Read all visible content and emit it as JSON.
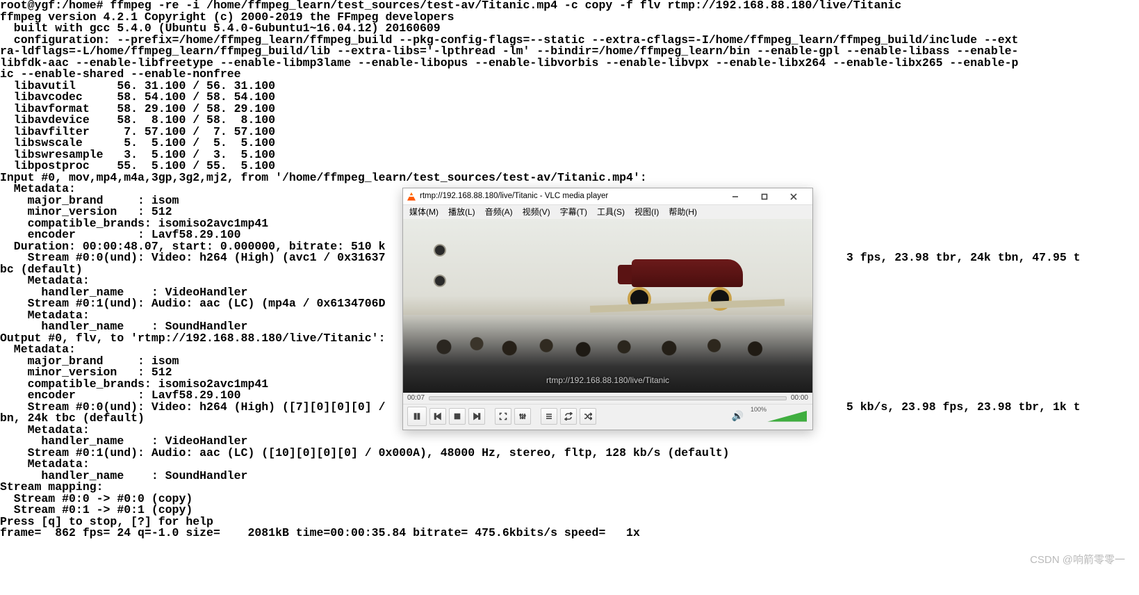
{
  "terminal_text": "root@ygf:/home# ffmpeg -re -i /home/ffmpeg_learn/test_sources/test-av/Titanic.mp4 -c copy -f flv rtmp://192.168.88.180/live/Titanic\nffmpeg version 4.2.1 Copyright (c) 2000-2019 the FFmpeg developers\n  built with gcc 5.4.0 (Ubuntu 5.4.0-6ubuntu1~16.04.12) 20160609\n  configuration: --prefix=/home/ffmpeg_learn/ffmpeg_build --pkg-config-flags=--static --extra-cflags=-I/home/ffmpeg_learn/ffmpeg_build/include --ext\nra-ldflags=-L/home/ffmpeg_learn/ffmpeg_build/lib --extra-libs='-lpthread -lm' --bindir=/home/ffmpeg_learn/bin --enable-gpl --enable-libass --enable-\nlibfdk-aac --enable-libfreetype --enable-libmp3lame --enable-libopus --enable-libvorbis --enable-libvpx --enable-libx264 --enable-libx265 --enable-p\nic --enable-shared --enable-nonfree\n  libavutil      56. 31.100 / 56. 31.100\n  libavcodec     58. 54.100 / 58. 54.100\n  libavformat    58. 29.100 / 58. 29.100\n  libavdevice    58.  8.100 / 58.  8.100\n  libavfilter     7. 57.100 /  7. 57.100\n  libswscale      5.  5.100 /  5.  5.100\n  libswresample   3.  5.100 /  3.  5.100\n  libpostproc    55.  5.100 / 55.  5.100\nInput #0, mov,mp4,m4a,3gp,3g2,mj2, from '/home/ffmpeg_learn/test_sources/test-av/Titanic.mp4':\n  Metadata:\n    major_brand     : isom\n    minor_version   : 512\n    compatible_brands: isomiso2avc1mp41\n    encoder         : Lavf58.29.100\n  Duration: 00:00:48.07, start: 0.000000, bitrate: 510 k\n    Stream #0:0(und): Video: h264 (High) (avc1 / 0x31637                                                                   3 fps, 23.98 tbr, 24k tbn, 47.95 t\nbc (default)\n    Metadata:\n      handler_name    : VideoHandler\n    Stream #0:1(und): Audio: aac (LC) (mp4a / 0x6134706D\n    Metadata:\n      handler_name    : SoundHandler\nOutput #0, flv, to 'rtmp://192.168.88.180/live/Titanic':\n  Metadata:\n    major_brand     : isom\n    minor_version   : 512\n    compatible_brands: isomiso2avc1mp41\n    encoder         : Lavf58.29.100\n    Stream #0:0(und): Video: h264 (High) ([7][0][0][0] /                                                                   5 kb/s, 23.98 fps, 23.98 tbr, 1k t\nbn, 24k tbc (default)\n    Metadata:\n      handler_name    : VideoHandler\n    Stream #0:1(und): Audio: aac (LC) ([10][0][0][0] / 0x000A), 48000 Hz, stereo, fltp, 128 kb/s (default)\n    Metadata:\n      handler_name    : SoundHandler\nStream mapping:\n  Stream #0:0 -> #0:0 (copy)\n  Stream #0:1 -> #0:1 (copy)\nPress [q] to stop, [?] for help\nframe=  862 fps= 24 q=-1.0 size=    2081kB time=00:00:35.84 bitrate= 475.6kbits/s speed=   1x",
  "watermark": "CSDN @响箭零零一",
  "vlc": {
    "title": "rtmp://192.168.88.180/live/Titanic - VLC media player",
    "menu": {
      "media": "媒体(M)",
      "playback": "播放(L)",
      "audio": "音频(A)",
      "video": "视频(V)",
      "subtitle": "字幕(T)",
      "tools": "工具(S)",
      "view": "视图(I)",
      "help": "帮助(H)"
    },
    "overlay_url": "rtmp://192.168.88.180/live/Titanic",
    "time_elapsed": "00:07",
    "time_total": "00:00",
    "volume_label": "100%"
  }
}
